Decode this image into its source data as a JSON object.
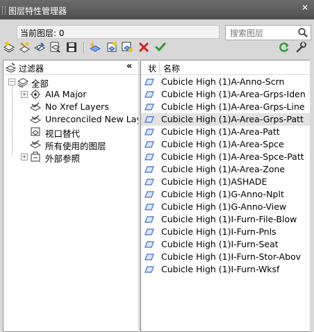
{
  "window": {
    "title": "图层特性管理器"
  },
  "header": {
    "current_layer": "当前图层: 0"
  },
  "search": {
    "placeholder": "搜索图层"
  },
  "toolbar": {
    "icons": [
      "new-filter-icon",
      "group-filter-icon",
      "state-manager-icon",
      "layer-state-icon",
      "save-icon",
      "new-layer-icon",
      "new-layer-vp-frozen-icon",
      "new-layer-vp-icon",
      "delete-layer-icon",
      "set-current-icon",
      "refresh-icon",
      "settings-icon"
    ]
  },
  "filters": {
    "header": "过滤器",
    "items": [
      {
        "label": "全部",
        "icon": "all-filter-icon"
      },
      {
        "label": "AIA Major",
        "icon": "group-filter-icon"
      },
      {
        "label": "No Xref Layers",
        "icon": "property-filter-icon"
      },
      {
        "label": "Unreconciled New Layers",
        "icon": "property-filter-icon"
      },
      {
        "label": "视口替代",
        "icon": "viewport-override-icon"
      },
      {
        "label": "所有使用的图层",
        "icon": "property-filter-icon"
      },
      {
        "label": "外部参照",
        "icon": "xref-icon"
      }
    ]
  },
  "layers": {
    "columns": {
      "status": "状",
      "name": "名称"
    },
    "rows": [
      "Cubicle High (1)A-Anno-Scrn",
      "Cubicle High (1)A-Area-Grps-Iden",
      "Cubicle High (1)A-Area-Grps-Line",
      "Cubicle High (1)A-Area-Grps-Patt",
      "Cubicle High (1)A-Area-Patt",
      "Cubicle High (1)A-Area-Spce",
      "Cubicle High (1)A-Area-Spce-Patt",
      "Cubicle High (1)A-Area-Zone",
      "Cubicle High (1)ASHADE",
      "Cubicle High (1)G-Anno-Nplt",
      "Cubicle High (1)G-Anno-View",
      "Cubicle High (1)I-Furn-File-Blow",
      "Cubicle High (1)I-Furn-Pnls",
      "Cubicle High (1)I-Furn-Seat",
      "Cubicle High (1)I-Furn-Stor-Abov",
      "Cubicle High (1)I-Furn-Wksf"
    ],
    "selected": "Cubicle High (1)A-Area-Grps-Patt"
  },
  "colors": {
    "title_bar": "#5a5a5a",
    "layer_icon": "#3a6fd0",
    "delete": "#d42020",
    "check": "#2e9b2e"
  }
}
